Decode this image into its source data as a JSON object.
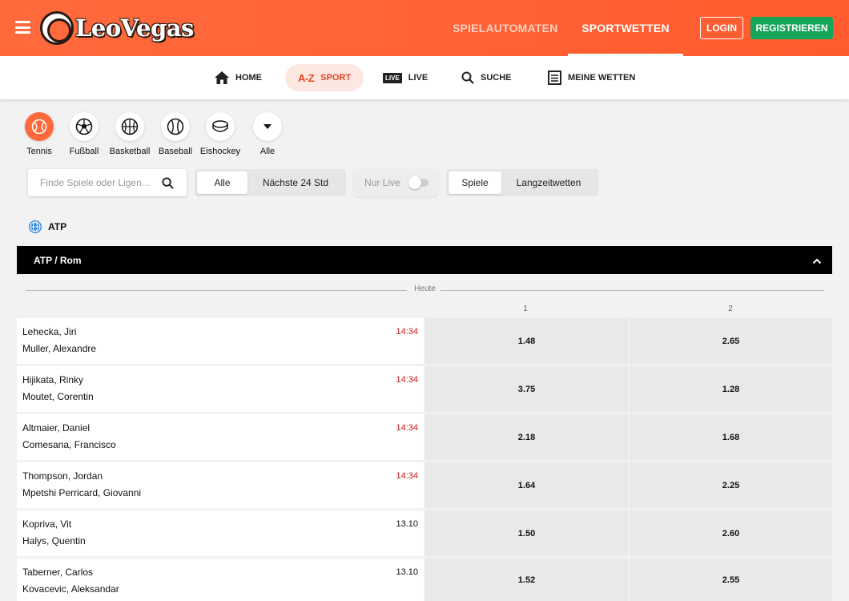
{
  "header": {
    "logo_text": "LeoVegas",
    "nav_slots": "SPIELAUTOMATEN",
    "nav_sports": "SPORTWETTEN",
    "login": "LOGIN",
    "register": "REGISTRIEREN",
    "brand_color": "#ff5b2e",
    "register_color": "#17a55a"
  },
  "subnav": {
    "home": "HOME",
    "az_icon": "A-Z",
    "sport": "SPORT",
    "live_icon": "LIVE",
    "live": "LIVE",
    "search": "SUCHE",
    "my_bets": "MEINE WETTEN"
  },
  "sports": [
    {
      "label": "Tennis",
      "icon": "tennis-icon",
      "active": true
    },
    {
      "label": "Fußball",
      "icon": "soccer-icon"
    },
    {
      "label": "Basketball",
      "icon": "basketball-icon"
    },
    {
      "label": "Baseball",
      "icon": "baseball-icon"
    },
    {
      "label": "Eishockey",
      "icon": "puck-icon"
    },
    {
      "label": "Alle",
      "icon": "caret-down-icon"
    }
  ],
  "filters": {
    "search_placeholder": "Finde Spiele oder Ligen...",
    "all": "Alle",
    "next24": "Nächste 24 Std",
    "only_live": "Nur Live",
    "games": "Spiele",
    "outrights": "Langzeitwetten"
  },
  "league": {
    "name": "ATP",
    "group": "ATP / Rom",
    "day": "Heute",
    "col1": "1",
    "col2": "2"
  },
  "matches": [
    {
      "p1": "Lehecka, Jiri",
      "p2": "Muller, Alexandre",
      "time": "14:34",
      "soon": true,
      "odd1": "1.48",
      "odd2": "2.65"
    },
    {
      "p1": "Hijikata, Rinky",
      "p2": "Moutet, Corentin",
      "time": "14:34",
      "soon": true,
      "odd1": "3.75",
      "odd2": "1.28"
    },
    {
      "p1": "Altmaier, Daniel",
      "p2": "Comesana, Francisco",
      "time": "14:34",
      "soon": true,
      "odd1": "2.18",
      "odd2": "1.68"
    },
    {
      "p1": "Thompson, Jordan",
      "p2": "Mpetshi Perricard, Giovanni",
      "time": "14:34",
      "soon": true,
      "odd1": "1.64",
      "odd2": "2.25"
    },
    {
      "p1": "Kopriva, Vit",
      "p2": "Halys, Quentin",
      "time": "13.10",
      "soon": false,
      "odd1": "1.50",
      "odd2": "2.60"
    },
    {
      "p1": "Taberner, Carlos",
      "p2": "Kovacevic, Aleksandar",
      "time": "13.10",
      "soon": false,
      "odd1": "1.52",
      "odd2": "2.55"
    }
  ]
}
